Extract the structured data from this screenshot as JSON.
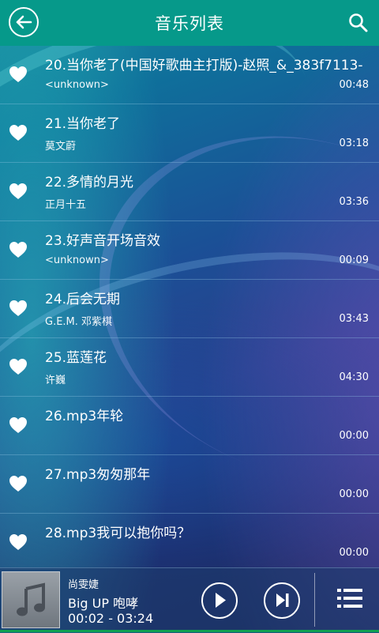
{
  "header": {
    "title": "音乐列表",
    "back_icon": "arrow-left-icon",
    "search_icon": "search-icon"
  },
  "songs": [
    {
      "title": "20.当你老了(中国好歌曲主打版)-赵照_&_383f7113-",
      "artist": "<unknown>",
      "duration": "00:48"
    },
    {
      "title": "21.当你老了",
      "artist": "莫文蔚",
      "duration": "03:18"
    },
    {
      "title": "22.多情的月光",
      "artist": "正月十五",
      "duration": "03:36"
    },
    {
      "title": "23.好声音开场音效",
      "artist": "<unknown>",
      "duration": "00:09"
    },
    {
      "title": "24.后会无期",
      "artist": "G.E.M. 邓紫棋",
      "duration": "03:43"
    },
    {
      "title": "25.蓝莲花",
      "artist": "许巍",
      "duration": "04:30"
    },
    {
      "title": "26.mp3年轮",
      "artist": "",
      "duration": "00:00"
    },
    {
      "title": "27.mp3匆匆那年",
      "artist": "",
      "duration": "00:00"
    },
    {
      "title": "28.mp3我可以抱你吗？",
      "artist": "",
      "duration": "00:00"
    }
  ],
  "now_playing": {
    "artist": "尚雯婕",
    "title": "Big UP 咆哮",
    "time": "00:02 - 03:24"
  },
  "colors": {
    "header": "#06998a",
    "accent_strip": "#10a050"
  }
}
